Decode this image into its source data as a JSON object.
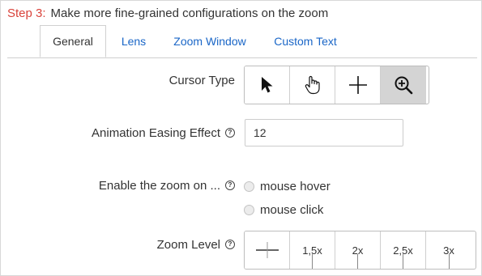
{
  "step": {
    "number": "Step 3:",
    "text": "Make more fine-grained configurations on the zoom"
  },
  "tabs": [
    {
      "label": "General",
      "active": true
    },
    {
      "label": "Lens"
    },
    {
      "label": "Zoom Window"
    },
    {
      "label": "Custom Text"
    }
  ],
  "cursor_type": {
    "label": "Cursor Type",
    "options": [
      "arrow-cursor-icon",
      "hand-cursor-icon",
      "crosshair-icon",
      "zoom-in-icon"
    ],
    "selected": "zoom-in-icon"
  },
  "easing": {
    "label": "Animation Easing Effect",
    "value": "12"
  },
  "enable_zoom": {
    "label": "Enable the zoom on ...",
    "options": [
      "mouse hover",
      "mouse click"
    ]
  },
  "zoom_level": {
    "label": "Zoom Level",
    "options": [
      "1,5x",
      "2x",
      "2,5x",
      "3x"
    ]
  },
  "help_glyph": "?",
  "colors": {
    "step_accent": "#d9433b",
    "link": "#1a66c7",
    "selected_bg": "#d4d4d4"
  }
}
